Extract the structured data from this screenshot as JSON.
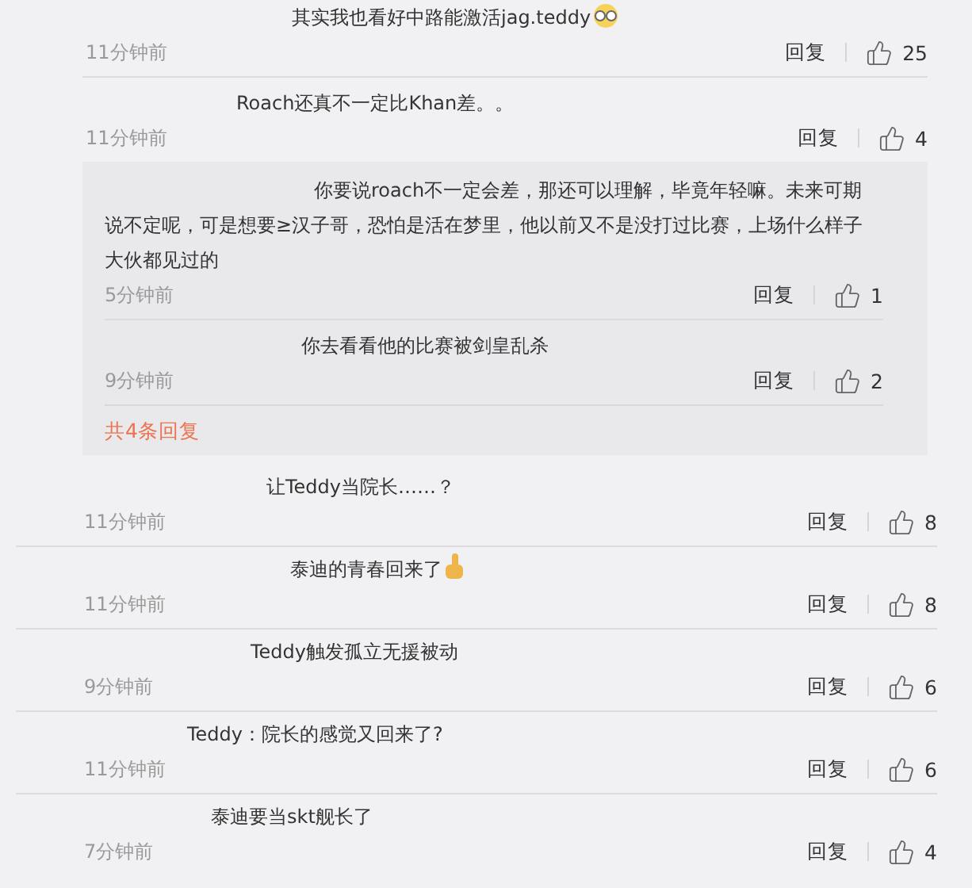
{
  "replies": [
    {
      "text": "其实我也看好中路能激活jag.teddy",
      "emoji": {
        "kind": "glasses"
      },
      "time": "11分钟前",
      "reply": "回复",
      "likes": "25"
    },
    {
      "text": "Roach还真不一定比Khan差。。",
      "time": "11分钟前",
      "reply": "回复",
      "likes": "4"
    }
  ],
  "reply_box": {
    "items": [
      {
        "text": "你要说roach不一定会差，那还可以理解，毕竟年轻嘛。未来可期说不定呢，可是想要≥汉子哥，恐怕是活在梦里，他以前又不是没打过比赛，上场什么样子大伙都见过的",
        "time": "5分钟前",
        "reply": "回复",
        "likes": "1"
      },
      {
        "text": "你去看看他的比赛被剑皇乱杀",
        "time": "9分钟前",
        "reply": "回复",
        "likes": "2"
      }
    ],
    "more": "共4条回复"
  },
  "comments": [
    {
      "text": "让Teddy当院长……？",
      "time": "11分钟前",
      "reply": "回复",
      "likes": "8"
    },
    {
      "text": "泰迪的青春回来了",
      "emoji": {
        "kind": "thumbs"
      },
      "time": "11分钟前",
      "reply": "回复",
      "likes": "8"
    },
    {
      "text": "Teddy触发孤立无援被动",
      "time": "9分钟前",
      "reply": "回复",
      "likes": "6"
    },
    {
      "text": "Teddy：院长的感觉又回来了?",
      "time": "11分钟前",
      "reply": "回复",
      "likes": "6"
    },
    {
      "text": "泰迪要当skt舰长了",
      "time": "7分钟前",
      "reply": "回复",
      "likes": "4"
    }
  ]
}
